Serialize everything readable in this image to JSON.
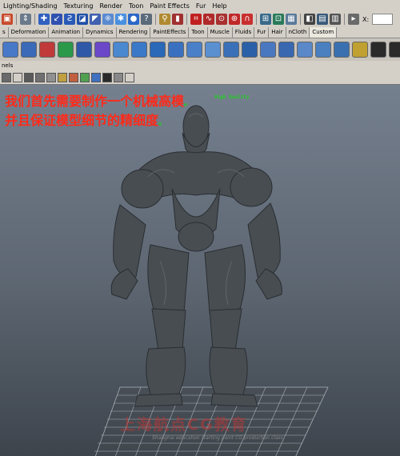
{
  "menubar": {
    "items": [
      "Lighting/Shading",
      "Texturing",
      "Render",
      "Toon",
      "Paint Effects",
      "Fur",
      "Help"
    ]
  },
  "toolbar": {
    "x_label": "X:"
  },
  "shelf": {
    "tabs": [
      "s",
      "Deformation",
      "Animation",
      "Dynamics",
      "Rendering",
      "PaintEffects",
      "Toon",
      "Muscle",
      "Fluids",
      "Fur",
      "Hair",
      "nCloth",
      "Custom"
    ]
  },
  "panel": {
    "menu_label": "nels"
  },
  "viewport": {
    "caption_line1": "我们首先需要制作一个机械高模",
    "caption_line2": "并且保证模型细节的精细度",
    "caption_dot": "。",
    "quality_label": "High Quality",
    "watermark_text": "上海航点CG教育",
    "watermark_sub": "Shanghai education starting point CG production class"
  },
  "colors": {
    "caption": "#ff2a1a",
    "quality": "#20d020",
    "viewport_top": "#75808f",
    "viewport_bottom": "#3d444c",
    "toolbar_bg": "#d4d0c8"
  }
}
